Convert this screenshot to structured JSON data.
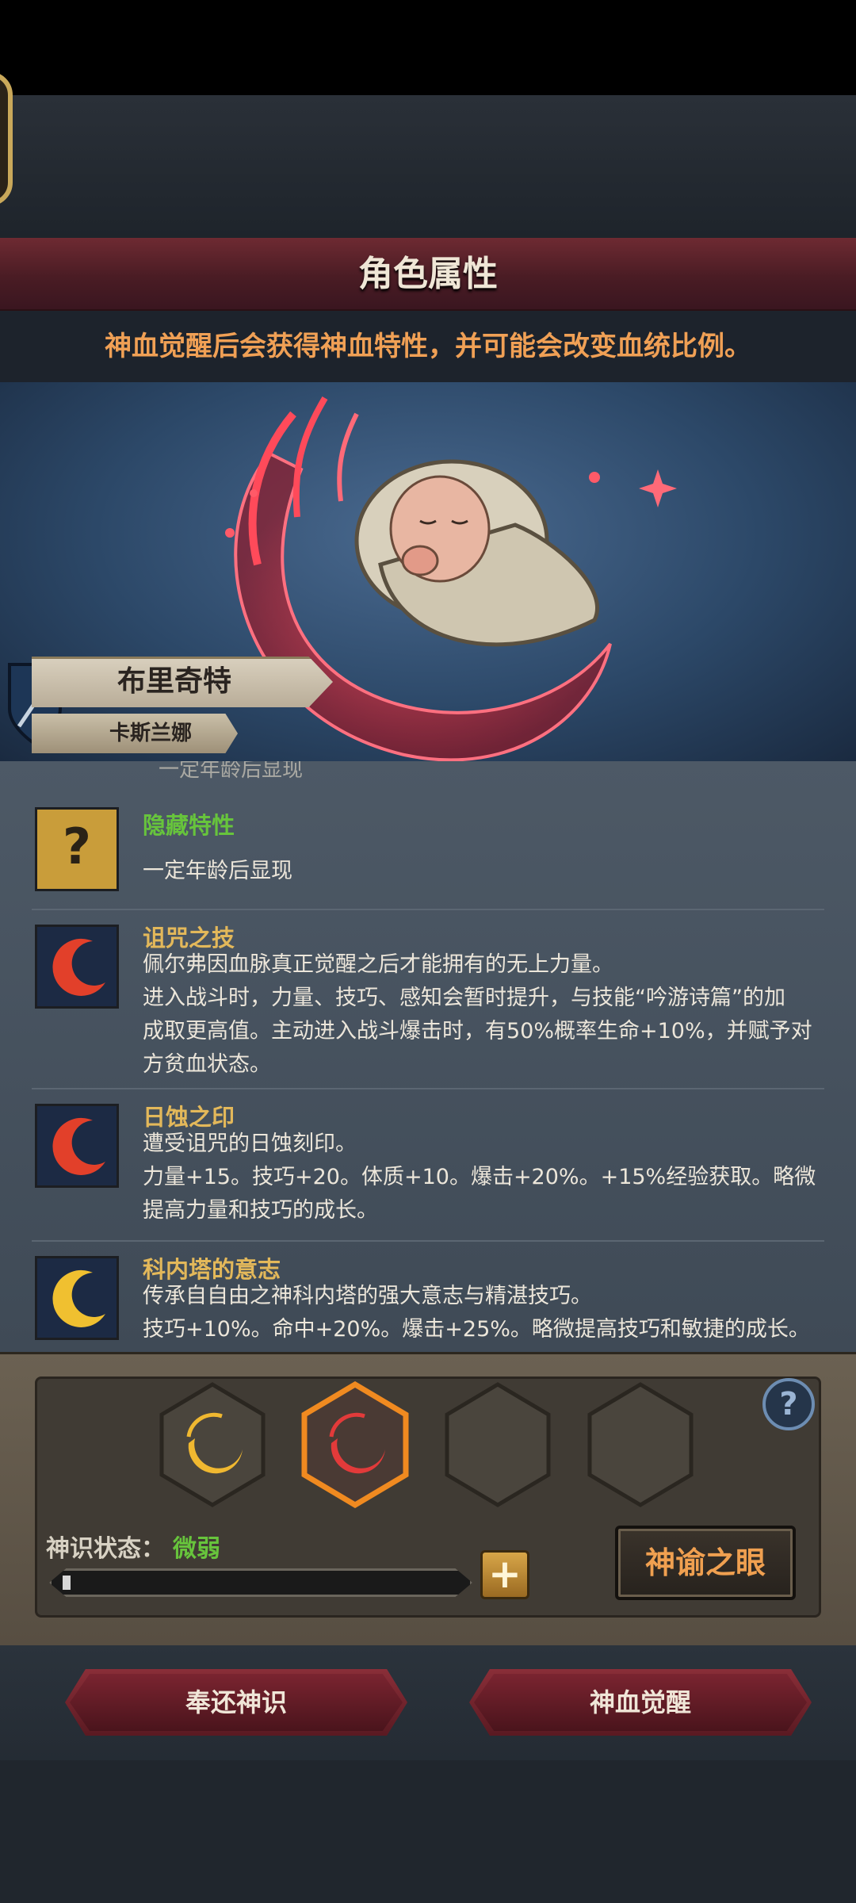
{
  "header": {
    "title": "角色属性",
    "notice": "神血觉醒后会获得神血特性，并可能会改变血统比例。"
  },
  "character": {
    "name": "布里奇特",
    "sub_name": "卡斯兰娜"
  },
  "traits": {
    "cut_off_text": "一定年龄后显现",
    "items": [
      {
        "name": "隐藏特性",
        "lines": [
          "一定年龄后显现"
        ],
        "icon": "question-mark-icon"
      },
      {
        "name": "诅咒之技",
        "lines": [
          "佩尔弗因血脉真正觉醒之后才能拥有的无上力量。",
          "进入战斗时，力量、技巧、感知会暂时提升，与技能“吟游诗篇”的加",
          "成取更高值。主动进入战斗爆击时，有50%概率生命+10%，并赋予对",
          "方贫血状态。"
        ],
        "icon": "red-crescent-icon"
      },
      {
        "name": "日蚀之印",
        "lines": [
          "遭受诅咒的日蚀刻印。",
          "力量+15。技巧+20。体质+10。爆击+20%。+15%经验获取。略微",
          "提高力量和技巧的成长。"
        ],
        "icon": "red-crescent-icon"
      },
      {
        "name": "科内塔的意志",
        "lines": [
          "传承自自由之神科内塔的强大意志与精湛技巧。",
          "技巧+10%。命中+20%。爆击+25%。略微提高技巧和敏捷的成长。"
        ],
        "icon": "gold-crescent-icon"
      }
    ]
  },
  "divine": {
    "status_label": "神识状态：",
    "status_value": "微弱",
    "progress": 0.02,
    "plus_label": "+",
    "help_label": "?",
    "oracle_button": "神谕之眼",
    "slots": [
      "gold-crescent-slot",
      "red-crescent-slot-selected",
      "empty-slot",
      "empty-slot"
    ]
  },
  "actions": {
    "return_label": "奉还神识",
    "awaken_label": "神血觉醒"
  },
  "colors": {
    "accent_orange": "#f0a055",
    "trait_gold": "#e3b85a",
    "status_green": "#67c43c",
    "title_red": "#6e2a32"
  }
}
